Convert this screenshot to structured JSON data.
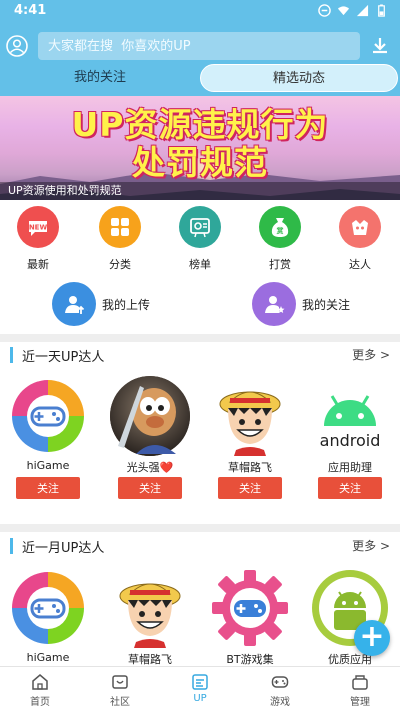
{
  "status_bar": {
    "time": "4:41"
  },
  "search": {
    "placeholder": "大家都在搜  你喜欢的UP"
  },
  "tabs": [
    {
      "label": "我的关注",
      "active": false
    },
    {
      "label": "精选动态",
      "active": true
    }
  ],
  "banner": {
    "title_line1": "UP资源违规行为",
    "title_line2": "处罚规范",
    "caption": "UP资源使用和处罚规范"
  },
  "categories": [
    {
      "label": "最新",
      "icon": "new-icon",
      "color": "#ef4f4f"
    },
    {
      "label": "分类",
      "icon": "grid-icon",
      "color": "#f7a21b"
    },
    {
      "label": "榜单",
      "icon": "rank-icon",
      "color": "#2fa79a"
    },
    {
      "label": "打赏",
      "icon": "reward-icon",
      "color": "#2fba48"
    },
    {
      "label": "达人",
      "icon": "expert-icon",
      "color": "#f4736d"
    }
  ],
  "quick_links": [
    {
      "label": "我的上传",
      "icon": "upload-icon",
      "color": "#3b8fe0"
    },
    {
      "label": "我的关注",
      "icon": "follow-user-icon",
      "color": "#9b6ddf"
    }
  ],
  "sections": [
    {
      "title": "近一天UP达人",
      "more": "更多 >",
      "users": [
        {
          "name": "hiGame",
          "avatar": "higame-logo",
          "button": "关注"
        },
        {
          "name": "光头强❤️",
          "avatar": "cartoon-avatar",
          "button": "关注"
        },
        {
          "name": "草帽路飞",
          "avatar": "luffy-avatar",
          "button": "关注"
        },
        {
          "name": "应用助理",
          "avatar": "android-logo",
          "button": "关注"
        }
      ]
    },
    {
      "title": "近一月UP达人",
      "more": "更多 >",
      "users": [
        {
          "name": "hiGame",
          "avatar": "higame-logo"
        },
        {
          "name": "草帽路飞",
          "avatar": "luffy-avatar"
        },
        {
          "name": "BT游戏集",
          "avatar": "gear-gamepad-logo"
        },
        {
          "name": "优质应用",
          "avatar": "android-circle-logo"
        }
      ]
    }
  ],
  "fab": {
    "symbol": "+"
  },
  "bottom_nav": [
    {
      "label": "首页",
      "icon": "home-icon",
      "active": false
    },
    {
      "label": "社区",
      "icon": "community-icon",
      "active": false
    },
    {
      "label": "UP",
      "icon": "up-icon",
      "active": true
    },
    {
      "label": "游戏",
      "icon": "gamepad-icon",
      "active": false
    },
    {
      "label": "管理",
      "icon": "manage-icon",
      "active": false
    }
  ],
  "colors": {
    "header": "#63c0e8",
    "accent": "#36a9e0",
    "follow_button": "#e8503a"
  }
}
